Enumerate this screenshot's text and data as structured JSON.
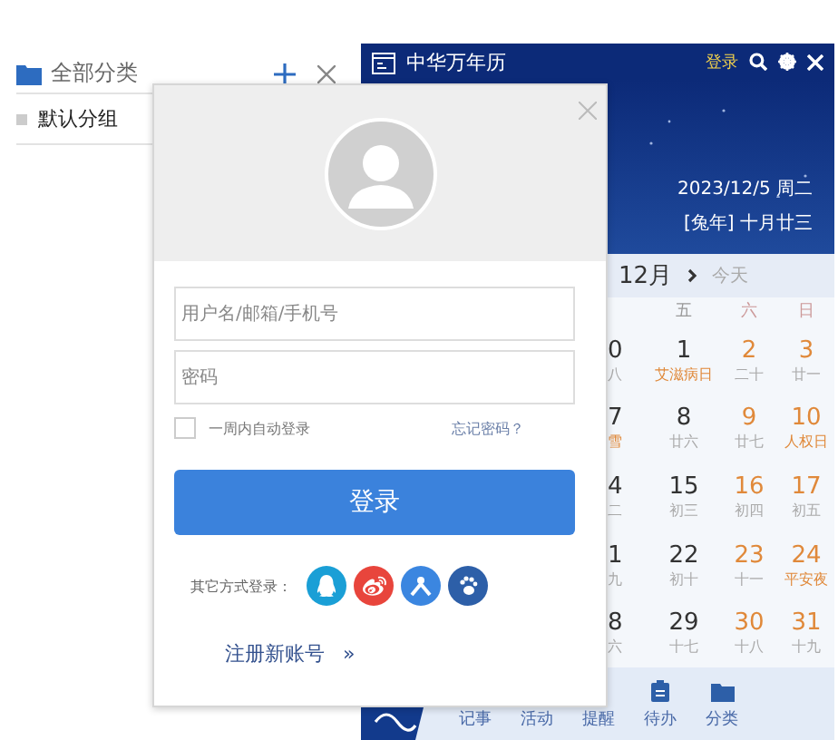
{
  "sidebar": {
    "title": "全部分类",
    "groups": [
      {
        "label": "默认分组"
      }
    ]
  },
  "calendar": {
    "app_title": "中华万年历",
    "login": "登录",
    "date": "2023/12/5 周二",
    "lunar_date": "[兔年] 十月廿三",
    "month": "12月",
    "today": "今天",
    "weekdays": [
      {
        "label": "五",
        "kind": "weekday"
      },
      {
        "label": "六",
        "kind": "weekend"
      },
      {
        "label": "日",
        "kind": "weekend"
      }
    ],
    "weeks": [
      [
        {
          "day": "0",
          "lunar": "八",
          "kind": "weekday",
          "festival": false
        },
        {
          "day": "1",
          "lunar": "艾滋病日",
          "kind": "weekday",
          "festival": true
        },
        {
          "day": "2",
          "lunar": "二十",
          "kind": "weekend",
          "festival": false
        },
        {
          "day": "3",
          "lunar": "廿一",
          "kind": "weekend",
          "festival": false
        }
      ],
      [
        {
          "day": "7",
          "lunar": "雪",
          "kind": "weekday",
          "festival": true
        },
        {
          "day": "8",
          "lunar": "廿六",
          "kind": "weekday",
          "festival": false
        },
        {
          "day": "9",
          "lunar": "廿七",
          "kind": "weekend",
          "festival": false
        },
        {
          "day": "10",
          "lunar": "人权日",
          "kind": "weekend",
          "festival": true
        }
      ],
      [
        {
          "day": "4",
          "lunar": "二",
          "kind": "weekday",
          "festival": false
        },
        {
          "day": "15",
          "lunar": "初三",
          "kind": "weekday",
          "festival": false
        },
        {
          "day": "16",
          "lunar": "初四",
          "kind": "weekend",
          "festival": false
        },
        {
          "day": "17",
          "lunar": "初五",
          "kind": "weekend",
          "festival": false
        }
      ],
      [
        {
          "day": "1",
          "lunar": "九",
          "kind": "weekday",
          "festival": false
        },
        {
          "day": "22",
          "lunar": "初十",
          "kind": "weekday",
          "festival": false
        },
        {
          "day": "23",
          "lunar": "十一",
          "kind": "weekend",
          "festival": false
        },
        {
          "day": "24",
          "lunar": "平安夜",
          "kind": "weekend",
          "festival": true
        }
      ],
      [
        {
          "day": "8",
          "lunar": "六",
          "kind": "weekday",
          "festival": false
        },
        {
          "day": "29",
          "lunar": "十七",
          "kind": "weekday",
          "festival": false
        },
        {
          "day": "30",
          "lunar": "十八",
          "kind": "weekend",
          "festival": false
        },
        {
          "day": "31",
          "lunar": "十九",
          "kind": "weekend",
          "festival": false
        }
      ]
    ],
    "tabs": [
      {
        "label": "记事",
        "kind": "label"
      },
      {
        "label": "活动",
        "kind": "label"
      },
      {
        "label": "提醒",
        "kind": "label"
      },
      {
        "label": "待办",
        "kind": "todo"
      },
      {
        "label": "分类",
        "kind": "folder"
      }
    ]
  },
  "login_dialog": {
    "username": {
      "placeholder": "用户名/邮箱/手机号"
    },
    "password": {
      "placeholder": "密码"
    },
    "remember": {
      "label": "一周内自动登录",
      "checked": false
    },
    "forgot": "忘记密码？",
    "submit": "登录",
    "other_label": "其它方式登录：",
    "providers": [
      {
        "kind": "qq",
        "color": "#1a9fd6"
      },
      {
        "kind": "weibo",
        "color": "#e8453c"
      },
      {
        "kind": "person",
        "color": "#3b86e0"
      },
      {
        "kind": "paw",
        "color": "#2d5fa8"
      }
    ],
    "register": "注册新账号",
    "register_arrow": "»"
  }
}
